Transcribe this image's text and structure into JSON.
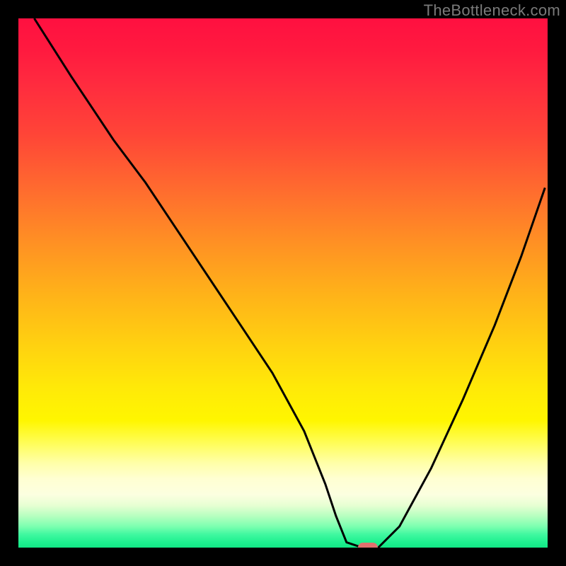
{
  "watermark": "TheBottleneck.com",
  "chart_data": {
    "type": "line",
    "title": "",
    "xlabel": "",
    "ylabel": "",
    "xlim": [
      0,
      100
    ],
    "ylim": [
      0,
      100
    ],
    "series": [
      {
        "name": "bottleneck-curve",
        "x": [
          3,
          10,
          18,
          24,
          30,
          36,
          42,
          48,
          54,
          58,
          60,
          62,
          65,
          68,
          72,
          78,
          84,
          90,
          95,
          99.5
        ],
        "values": [
          100,
          89,
          77,
          69,
          60,
          51,
          42,
          33,
          22,
          12,
          6,
          1,
          0,
          0,
          4,
          15,
          28,
          42,
          55,
          68
        ]
      }
    ],
    "marker": {
      "x": 66,
      "y": 0
    },
    "grid": false
  },
  "colors": {
    "curve_stroke": "#000000",
    "marker_fill": "#e0706e",
    "watermark": "#7a7a7a",
    "background": "#000000"
  }
}
